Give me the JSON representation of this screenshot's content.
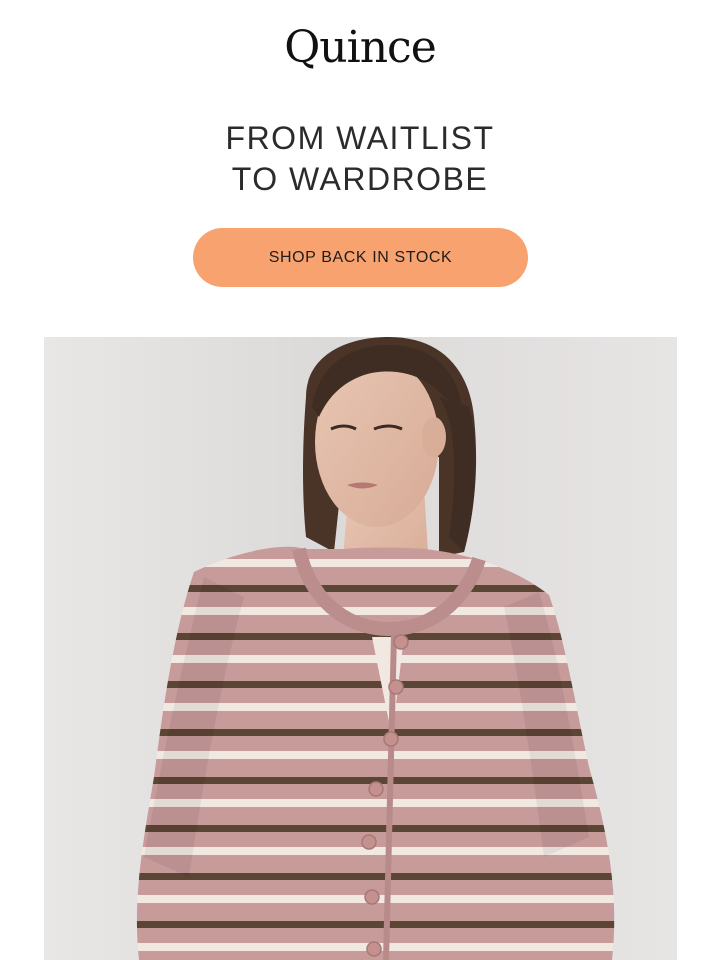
{
  "brand": {
    "logo_text": "Quince"
  },
  "headline": {
    "line1": "FROM WAITLIST",
    "line2": "TO WARDROBE"
  },
  "cta": {
    "label": "SHOP BACK IN STOCK"
  },
  "colors": {
    "cta_background": "#f8a26f",
    "text": "#2b2b2b",
    "sweater_pink": "#c69b9a",
    "stripe_brown": "#5b4535",
    "stripe_cream": "#f1e8e2"
  },
  "hero_image": {
    "icon": "model-wearing-striped-cardigan"
  }
}
